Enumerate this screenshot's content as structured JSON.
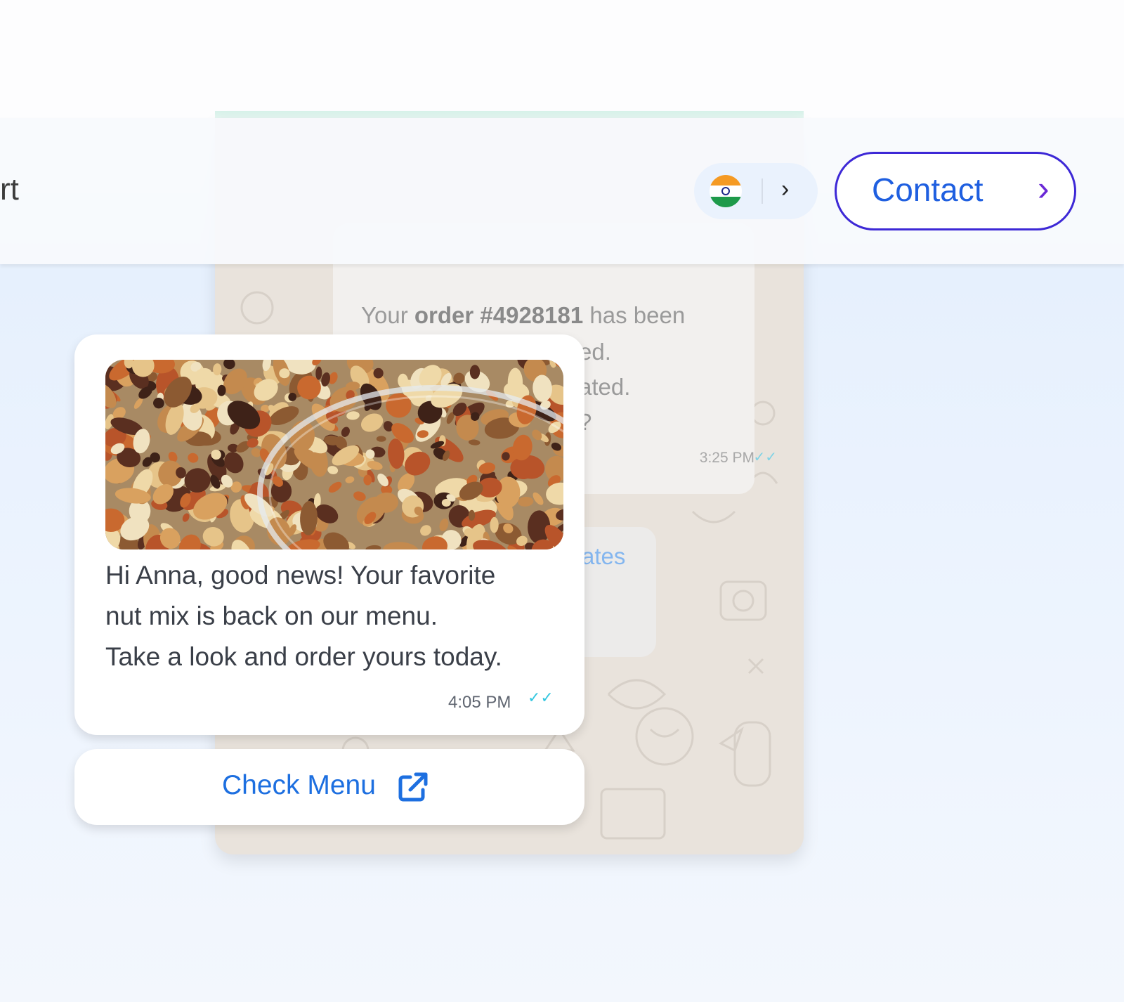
{
  "header": {
    "partial_nav_text": "rt",
    "language_selector": {
      "flag_icon": "india-flag-icon",
      "chevron": "›"
    },
    "contact_button": {
      "label": "Contact",
      "chevron": "›"
    }
  },
  "background_chat": {
    "order_message": {
      "line1_prefix": "Your ",
      "line1_bold": "order #4928181",
      "line1_suffix": " has been",
      "line2": "ed.",
      "line3": "ated.",
      "line4": "?",
      "time": "3:25 PM"
    },
    "partial_link": "ates"
  },
  "message": {
    "image_alt": "nut mix in glass bowl",
    "text_line1": "Hi Anna, good news! Your favorite",
    "text_line2": "nut mix is back on our menu.",
    "text_line3": "Take a look and order yours today.",
    "time": "4:05 PM",
    "tick": "✓✓"
  },
  "cta": {
    "label": "Check Menu",
    "icon": "external-link-icon"
  },
  "colors": {
    "accent_blue": "#1f5fe0",
    "contact_border": "#3d28d6",
    "read_tick": "#36c7e0",
    "chat_bg": "#e9e3dc"
  }
}
